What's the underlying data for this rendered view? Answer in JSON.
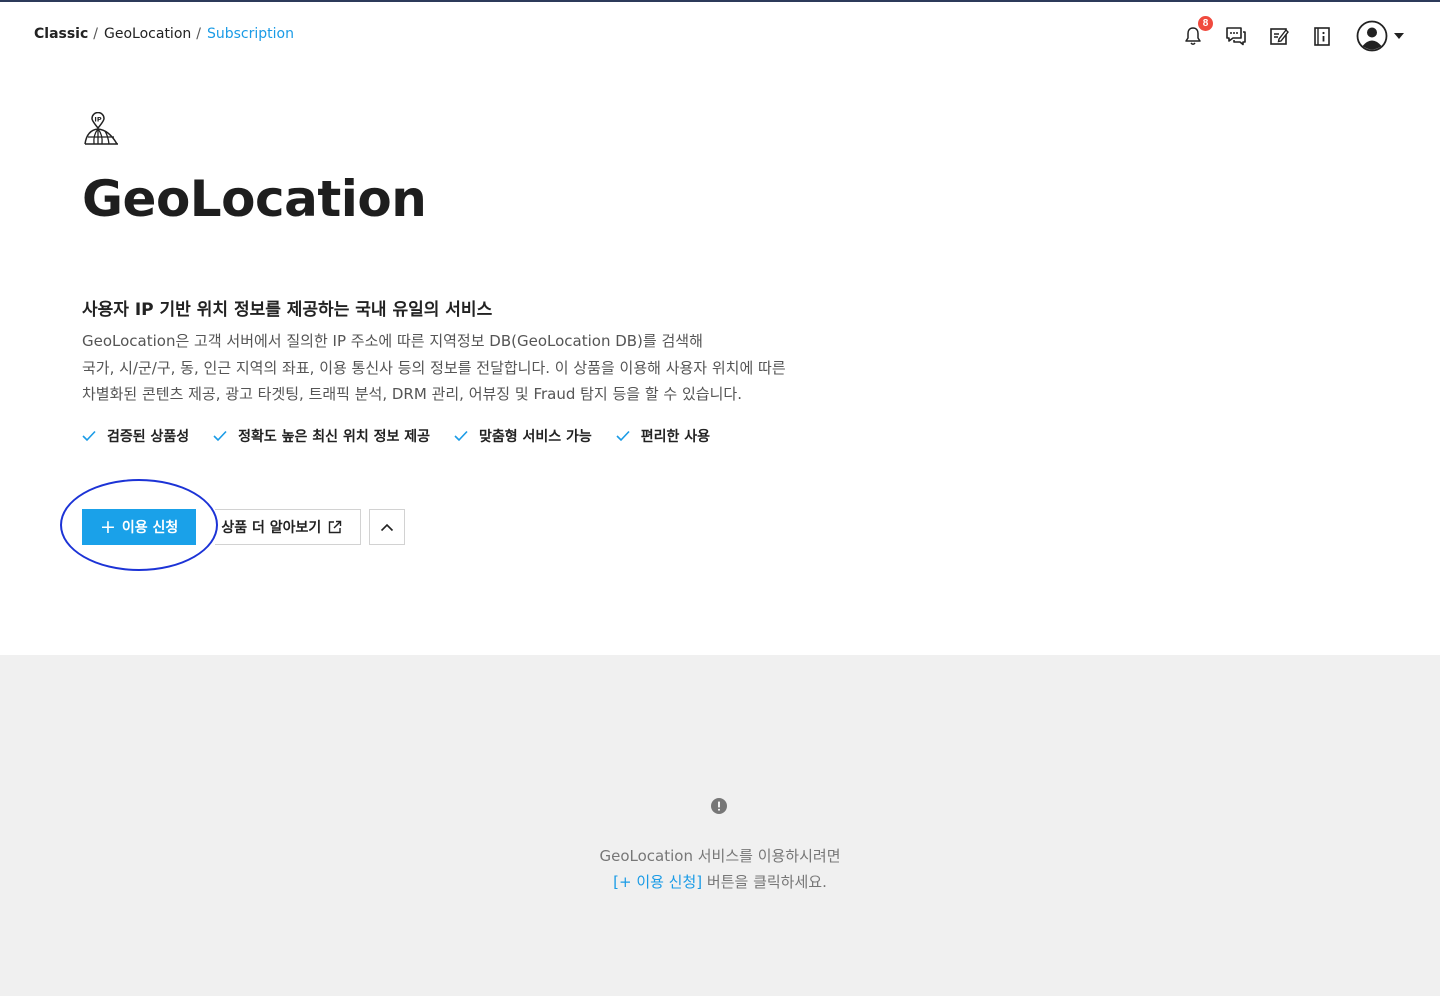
{
  "breadcrumb": {
    "items": [
      "Classic",
      "GeoLocation",
      "Subscription"
    ],
    "separator": "/"
  },
  "header": {
    "notification_count": "8",
    "icons": [
      "bell-icon",
      "chat-icon",
      "memo-icon",
      "info-book-icon",
      "user-avatar-icon",
      "caret-down-icon"
    ]
  },
  "product": {
    "icon": "ip-globe-icon",
    "title": "GeoLocation",
    "subtitle": "사용자 IP 기반 위치 정보를 제공하는 국내 유일의 서비스",
    "description": [
      "GeoLocation은 고객 서버에서 질의한 IP 주소에 따른 지역정보 DB(GeoLocation DB)를 검색해",
      "국가, 시/군/구, 동, 인근 지역의 좌표, 이용 통신사 등의 정보를 전달합니다. 이 상품을 이용해 사용자 위치에 따른",
      "차별화된 콘텐츠 제공, 광고 타겟팅, 트래픽 분석, DRM 관리, 어뷰징 및 Fraud 탐지 등을 할 수 있습니다."
    ],
    "features": [
      "검증된 상품성",
      "정확도 높은 최신 위치 정보 제공",
      "맞춤형 서비스 가능",
      "편리한 사용"
    ]
  },
  "actions": {
    "subscribe_plus": "+",
    "subscribe_label": "이용 신청",
    "learn_more_label": "상품 더 알아보기"
  },
  "info_panel": {
    "line1": "GeoLocation 서비스를 이용하시려면",
    "link_text": "[+ 이용 신청]",
    "line2_suffix": " 버튼을 클릭하세요."
  },
  "colors": {
    "accent": "#1aa1e9",
    "link": "#1a9be6",
    "badge": "#f04a3e",
    "highlight": "#1c33d6",
    "panel_bg": "#f0f0f0"
  }
}
